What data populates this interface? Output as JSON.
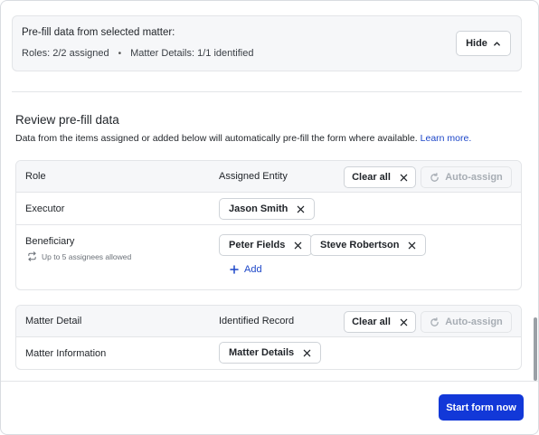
{
  "prefill": {
    "title": "Pre-fill data from selected matter:",
    "roles_summary": "Roles: 2/2 assigned",
    "separator": "•",
    "matter_summary": "Matter Details: 1/1 identified",
    "hide_label": "Hide"
  },
  "review": {
    "title": "Review pre-fill data",
    "description": "Data from the items assigned or added below will automatically pre-fill the form where available.",
    "learn_more": "Learn more."
  },
  "roles_table": {
    "col_role": "Role",
    "col_entity": "Assigned Entity",
    "clear_all": "Clear all",
    "auto_assign": "Auto-assign",
    "rows": [
      {
        "role": "Executor",
        "entities": [
          "Jason Smith"
        ]
      },
      {
        "role": "Beneficiary",
        "hint": "Up to 5 assignees allowed",
        "entities": [
          "Peter Fields",
          "Steve Robertson"
        ],
        "add_label": "Add"
      }
    ]
  },
  "matter_table": {
    "col_detail": "Matter Detail",
    "col_record": "Identified Record",
    "clear_all": "Clear all",
    "auto_assign": "Auto-assign",
    "rows": [
      {
        "detail": "Matter Information",
        "records": [
          "Matter Details"
        ]
      }
    ]
  },
  "footer": {
    "start_label": "Start form now"
  },
  "colors": {
    "primary": "#1238d8",
    "link": "#1c46c8",
    "header_bg": "#f6f7f9",
    "border": "#e3e5e8"
  }
}
